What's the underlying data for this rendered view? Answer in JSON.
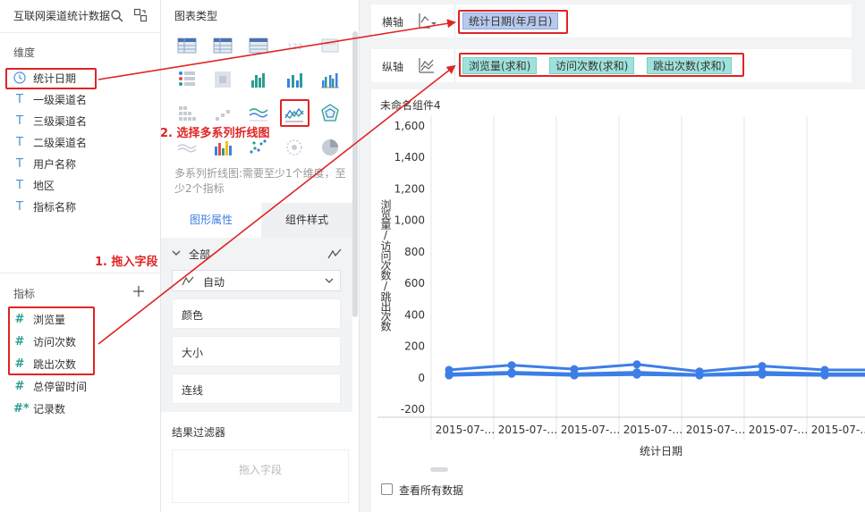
{
  "field_panel": {
    "dataset_title": "互联网渠道统计数据",
    "dimensions_title": "维度",
    "dimensions": [
      {
        "label": "统计日期",
        "icon": "clock-icon"
      },
      {
        "label": "一级渠道名",
        "icon": "text-field-icon"
      },
      {
        "label": "三级渠道名",
        "icon": "text-field-icon"
      },
      {
        "label": "二级渠道名",
        "icon": "text-field-icon"
      },
      {
        "label": "用户名称",
        "icon": "text-field-icon"
      },
      {
        "label": "地区",
        "icon": "text-field-icon"
      },
      {
        "label": "指标名称",
        "icon": "text-field-icon"
      }
    ],
    "measures_title": "指标",
    "measures": [
      {
        "label": "浏览量",
        "icon_text": "#"
      },
      {
        "label": "访问次数",
        "icon_text": "#"
      },
      {
        "label": "跳出次数",
        "icon_text": "#"
      },
      {
        "label": "总停留时间",
        "icon_text": "#"
      },
      {
        "label": "记录数",
        "icon_text": "#*"
      }
    ]
  },
  "type_panel": {
    "title": "图表类型",
    "selected_chart": "multi-series-line-chart",
    "description": "多系列折线图:需要至少1个维度，至少2个指标",
    "tabs": [
      "图形属性",
      "组件样式"
    ],
    "all_label": "全部",
    "mode_value": "自动",
    "properties": [
      "颜色",
      "大小",
      "连线"
    ],
    "filter_title": "结果过滤器",
    "filter_placeholder": "拖入字段"
  },
  "axes": {
    "x_label": "横轴",
    "y_label": "纵轴",
    "x_fields": [
      "统计日期(年月日)"
    ],
    "y_fields": [
      "浏览量(求和)",
      "访问次数(求和)",
      "跳出次数(求和)"
    ]
  },
  "chart_card": {
    "title": "未命名组件4",
    "view_all_label": "查看所有数据"
  },
  "chart_data": {
    "type": "line",
    "xlabel": "统计日期",
    "ylabel": "浏览量/访问次数/跳出次数",
    "ylim": [
      -200,
      1600
    ],
    "yticks": [
      "1,600",
      "1,400",
      "1,200",
      "1,000",
      "800",
      "600",
      "400",
      "200",
      "0",
      "-200"
    ],
    "ytick_values": [
      1600,
      1400,
      1200,
      1000,
      800,
      600,
      400,
      200,
      0,
      -200
    ],
    "categories": [
      "2015-07-…",
      "2015-07-…",
      "2015-07-…",
      "2015-07-…",
      "2015-07-…",
      "2015-07-…",
      "2015-07-…"
    ],
    "grid": true,
    "series": [
      {
        "values": [
          50,
          80,
          55,
          85,
          40,
          75,
          50
        ],
        "color": "#3d7ee6"
      },
      {
        "values": [
          25,
          35,
          25,
          35,
          20,
          35,
          25
        ],
        "color": "#3d7ee6"
      },
      {
        "values": [
          15,
          25,
          15,
          20,
          15,
          20,
          15
        ],
        "color": "#3d7ee6"
      }
    ]
  },
  "annotations": {
    "step1": "1. 拖入字段",
    "step2": "2. 选择多系列折线图",
    "color": "#e02424"
  }
}
